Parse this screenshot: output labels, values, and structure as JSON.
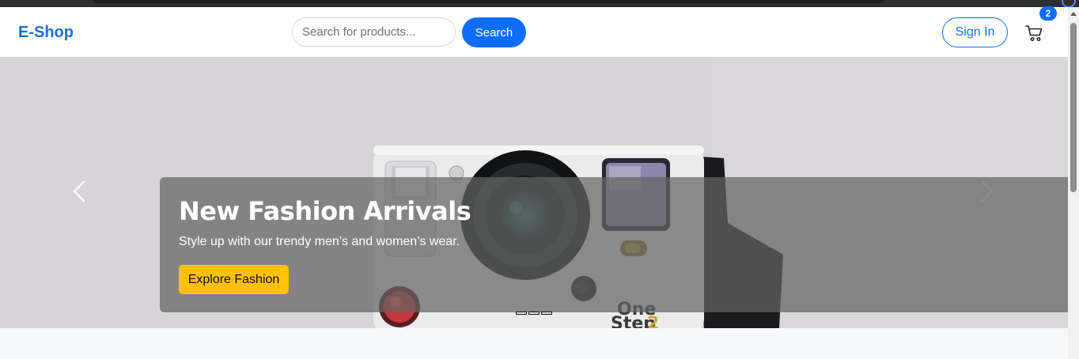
{
  "header": {
    "brand": "E-Shop",
    "search": {
      "placeholder": "Search for products...",
      "value": ""
    },
    "search_button": "Search",
    "signin_button": "Sign In",
    "cart": {
      "icon": "cart-icon",
      "count": "2"
    }
  },
  "carousel": {
    "slide": {
      "title": "New Fashion Arrivals",
      "text": "Style up with our trendy men’s and women’s wear.",
      "cta": "Explore Fashion",
      "image": "instant-camera-photo"
    },
    "prev_icon": "chevron-left-icon",
    "next_icon": "chevron-right-icon",
    "indicator_count": 3
  },
  "colors": {
    "brand": "#1a6fd1",
    "primary": "#0d6efd",
    "cta": "#ffc107",
    "caption_overlay": "rgba(100,100,100,0.72)"
  }
}
